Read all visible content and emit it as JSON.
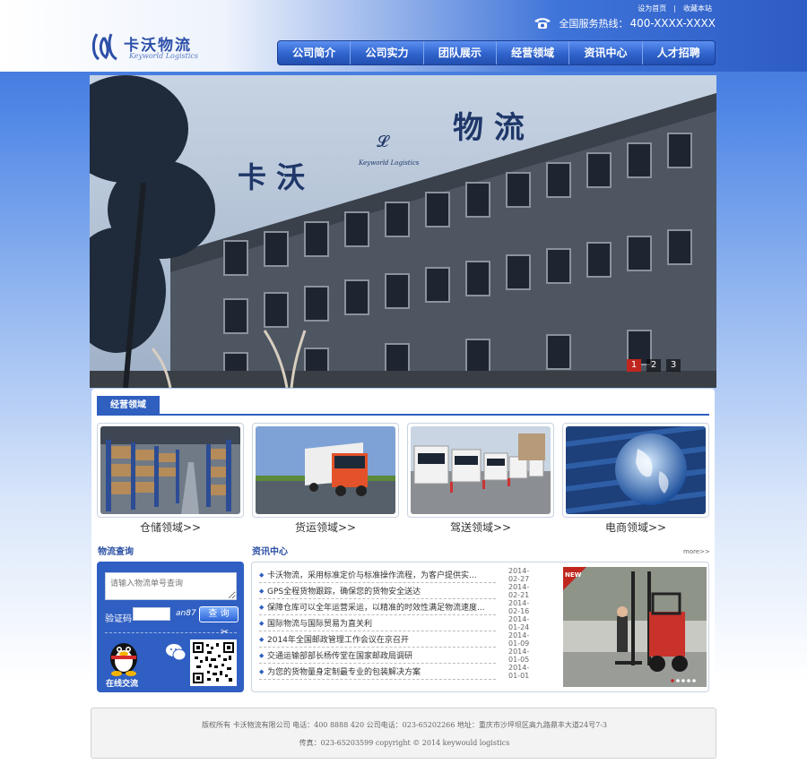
{
  "brand": {
    "name_cn": "卡沃物流",
    "name_en": "Keyworld Logistics",
    "logo_color": "#2c4fa8"
  },
  "top_links": [
    "设为首页",
    "|",
    "收藏本站"
  ],
  "hotline": {
    "label": "全国服务热线：",
    "number": "400-XXXX-XXXX"
  },
  "nav": [
    "公司简介",
    "公司实力",
    "团队展示",
    "经营领域",
    "资讯中心",
    "人才招聘"
  ],
  "banner": {
    "sign_left": "卡 沃",
    "sign_right": "物 流",
    "sign_logo_en": "Keyworld Logistics",
    "slides": [
      "1",
      "2",
      "3"
    ],
    "active_slide": 1
  },
  "business": {
    "tab": "经营领域",
    "items": [
      {
        "label": "仓储领域>>",
        "image": "warehouse"
      },
      {
        "label": "货运领域>>",
        "image": "truck"
      },
      {
        "label": "驾送领域>>",
        "image": "fleet"
      },
      {
        "label": "电商领域>>",
        "image": "globe"
      }
    ]
  },
  "query": {
    "title": "物流查询",
    "placeholder": "请输入物流单号查询",
    "code_label": "验证码",
    "captcha": "an87",
    "button": "查 询",
    "online": "在线交流"
  },
  "news": {
    "title": "资讯中心",
    "more": "more>>",
    "badge": "NEW",
    "items": [
      {
        "title": "卡沃物流，采用标准定价与标准操作流程，为客户提供实...",
        "date": "2014-02-27"
      },
      {
        "title": "GPS全程货物跟踪，确保您的货物安全送达",
        "date": "2014-02-21"
      },
      {
        "title": "保障仓库可以全年运营采运，以精准的时效性满足物流速度...",
        "date": "2014-02-16"
      },
      {
        "title": "国际物流与国际贸易为直关利",
        "date": "2014-01-24"
      },
      {
        "title": "2014年全国邮政管理工作会议在京召开",
        "date": "2014-01-09"
      },
      {
        "title": "交通运输部部长杨传堂在国家邮政局调研",
        "date": "2014-01-05"
      },
      {
        "title": "为您的货物量身定制最专业的包装解决方案",
        "date": "2014-01-01"
      }
    ]
  },
  "footer": {
    "line1": "版权所有  卡沃物流有限公司     电话：400 8888 420   公司电话：023-65202266     地址：重庆市沙坪坝区高九路鼎丰大道24号7-3",
    "line2": "传真：023-65203599          copyright © 2014 keywould logistics"
  },
  "colors": {
    "nav": "#2f63cc",
    "accent": "#2f5fbf",
    "active_dot": "#c0261e"
  }
}
